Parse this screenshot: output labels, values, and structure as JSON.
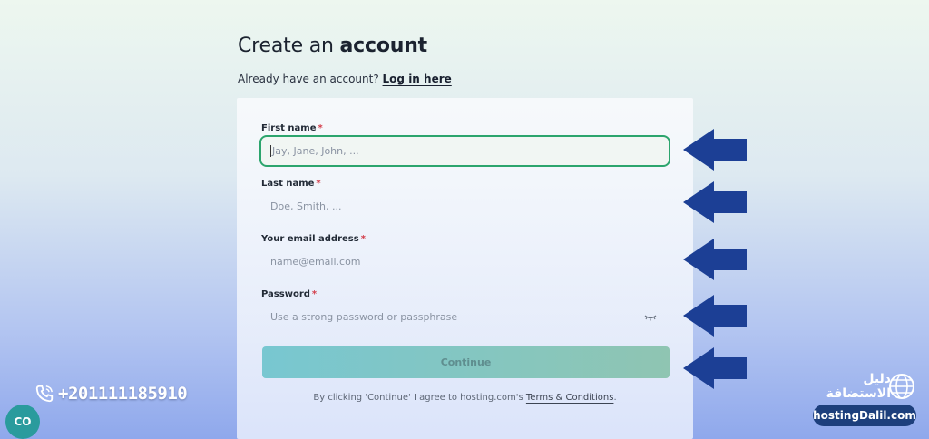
{
  "heading": {
    "prefix": "Create an",
    "bold": "account"
  },
  "subheading": {
    "text": "Already have an account?",
    "link": "Log in here"
  },
  "form": {
    "first_name": {
      "label": "First name",
      "required": "*",
      "placeholder": "Jay, Jane, John, ..."
    },
    "last_name": {
      "label": "Last name",
      "required": "*",
      "placeholder": "Doe, Smith, ..."
    },
    "email": {
      "label": "Your email address",
      "required": "*",
      "placeholder": "name@email.com"
    },
    "password": {
      "label": "Password",
      "required": "*",
      "placeholder": "Use a strong password or passphrase"
    },
    "continue_label": "Continue",
    "terms": {
      "prefix": "By clicking 'Continue' I agree to hosting.com's",
      "link": "Terms & Conditions",
      "suffix": "."
    }
  },
  "annotations": {
    "arrow_color": "#1c3f95",
    "icon": "arrow-left-icon",
    "count": 5
  },
  "overlay": {
    "phone": "+201111185910",
    "chat_button": "CO",
    "watermark": {
      "arabic_line1": "دليل",
      "arabic_line2": "الاستضافة",
      "english": "hostingDalil.com"
    }
  },
  "colors": {
    "focus": "#2ca56d",
    "required": "#d33d4a",
    "button": "#78c7d1"
  }
}
